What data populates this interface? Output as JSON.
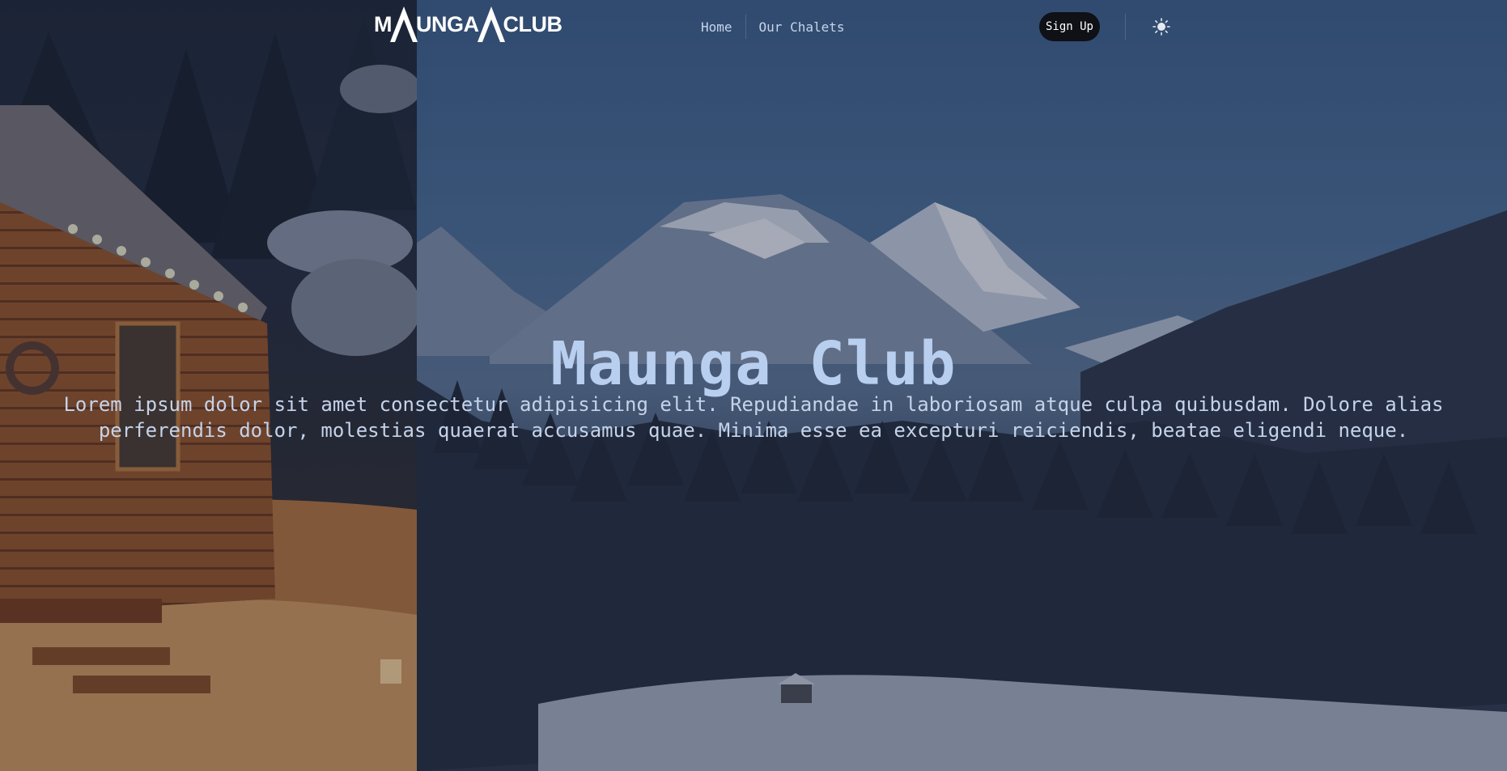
{
  "brand": {
    "logo_text_left": "M",
    "logo_text_mid": "UNGA",
    "logo_text_right": "CLUB"
  },
  "nav": {
    "links": [
      {
        "label": "Home"
      },
      {
        "label": "Our Chalets"
      }
    ],
    "signup_label": "Sign Up",
    "theme_icon": "sun-icon"
  },
  "hero": {
    "title": "Maunga Club",
    "text": "Lorem ipsum dolor sit amet consectetur adipisicing elit. Repudiandae in laboriosam atque culpa quibusdam. Dolore alias perferendis dolor, molestias quaerat accusamus quae. Minima esse ea excepturi reiciendis, beatae eligendi neque."
  },
  "colors": {
    "title": "#b8cff0",
    "text": "#c5d3ea",
    "signup_bg": "#0f1117",
    "nav_link": "#c7d4ea"
  }
}
